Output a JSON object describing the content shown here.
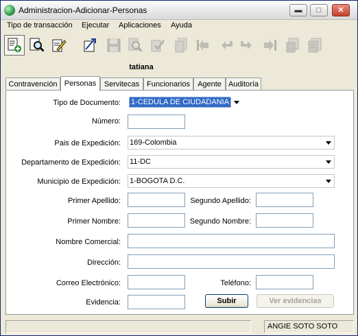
{
  "window": {
    "title": "Administracion-Adicionar-Personas",
    "buttons": {
      "minimize": "▬",
      "maximize": "□",
      "close": "✕"
    }
  },
  "menu": [
    "Tipo de transacción",
    "Ejecutar",
    "Aplicaciones",
    "Ayuda"
  ],
  "toolbar": {
    "icons": [
      "add-record-icon",
      "search-icon",
      "edit-icon",
      "launch-icon",
      "save-icon",
      "delete-icon",
      "approve-icon",
      "copy-icon",
      "first-record-icon",
      "previous-icon",
      "next-icon",
      "last-record-icon",
      "export-icon",
      "report-icon"
    ]
  },
  "user_label": "tatiana",
  "tabs": [
    "Contravención",
    "Personas",
    "Servitecas",
    "Funcionarios",
    "Agente",
    "Auditoría"
  ],
  "selected_tab": "Personas",
  "form": {
    "tipo_documento": {
      "label": "Tipo de Documento:",
      "value": "1-CEDULA DE CIUDADANIA"
    },
    "numero": {
      "label": "Número:",
      "value": ""
    },
    "pais": {
      "label": "Pais de Expedición:",
      "value": "169-Colombia"
    },
    "departamento": {
      "label": "Departamento de Expedición:",
      "value": "11-DC"
    },
    "municipio": {
      "label": "Municipio de Expedición:",
      "value": "1-BOGOTA D.C."
    },
    "primer_apellido": {
      "label": "Primer Apellido:",
      "value": ""
    },
    "segundo_apellido": {
      "label": "Segundo Apellido:",
      "value": ""
    },
    "primer_nombre": {
      "label": "Primer Nombre:",
      "value": ""
    },
    "segundo_nombre": {
      "label": "Segundo Nombre:",
      "value": ""
    },
    "nombre_comercial": {
      "label": "Nombre Comercial:",
      "value": ""
    },
    "direccion": {
      "label": "Dirección:",
      "value": ""
    },
    "correo": {
      "label": "Correo Electrónico:",
      "value": ""
    },
    "telefono": {
      "label": "Teléfono:",
      "value": ""
    },
    "evidencia": {
      "label": "Evidencia:",
      "value": ""
    },
    "submit_label": "Subir",
    "view_label": "Ver evidencias"
  },
  "status": {
    "left": "",
    "user": "ANGIE  SOTO SOTO"
  }
}
